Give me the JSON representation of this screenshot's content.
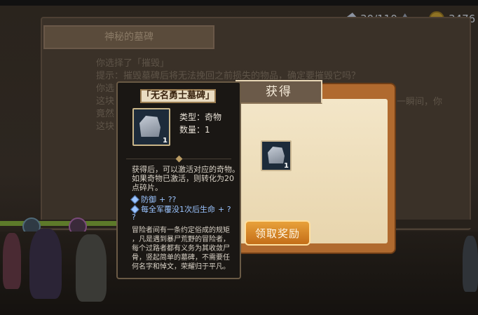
{
  "colors": {
    "accent_orange": "#d98a2b",
    "stat_blue": "#9bc4ff",
    "panel_dark": "#1a1714"
  },
  "currency": {
    "gems": "30/110",
    "gold": "3476"
  },
  "background_event": {
    "title": "神秘的墓碑",
    "lines": [
      "你选择了「摧毁」",
      "提示：摧毁墓碑后将无法挽回之前损失的物品，确定要摧毁它吗？",
      "你选",
      "这块",
      "竟然",
      "这块"
    ],
    "right_fragment": "一瞬间，你"
  },
  "reward_panel": {
    "title": "获得",
    "item_icon": "tombstone-icon",
    "item_count": "1",
    "claim_label": "领取奖励"
  },
  "item_tooltip": {
    "name": "「无名勇士墓碑」",
    "item_icon": "tombstone-icon",
    "item_count": "1",
    "type_label": "类型：奇物",
    "quantity_label": "数量：1",
    "description_lines": [
      "获得后，可以激活对应的奇物。",
      "如果奇物已激活，则转化为20",
      "点碎片。"
    ],
    "stats": [
      {
        "label": "防御",
        "value": "+ ??"
      },
      {
        "label": "每全军覆没1次后生命",
        "value": "+ ?"
      }
    ],
    "stat_overflow": "?",
    "lore_lines": [
      "冒险者间有一条约定俗成的规矩",
      "，凡是遇到暴尸荒野的冒险者，",
      "每个过路者都有义务为其收敛尸",
      "骨，竖起简单的墓碑，不需要任",
      "何名字和悼文，荣耀归于平凡。"
    ]
  }
}
